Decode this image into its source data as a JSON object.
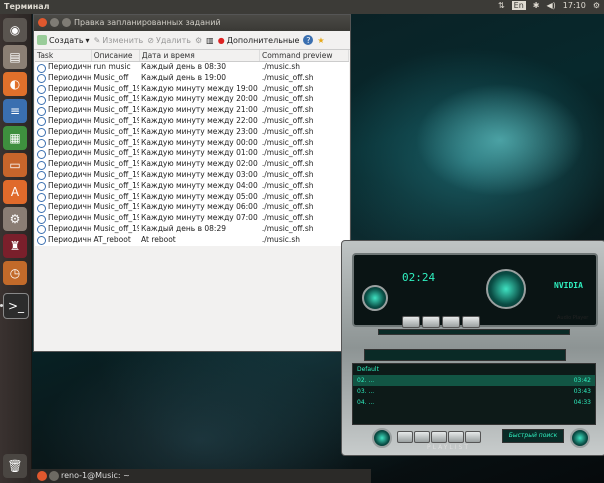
{
  "topbar": {
    "title": "Терминал",
    "time": "17:10",
    "lang": "En"
  },
  "taskbar": {
    "label": "reno-1@Music: ~"
  },
  "window": {
    "title": "Правка запланированных заданий",
    "toolbar": {
      "create": "Создать",
      "edit": "Изменить",
      "delete": "Удалить",
      "advanced": "Дополнительные"
    },
    "columns": [
      "Task",
      "Описание",
      "Дата и время",
      "Command preview"
    ],
    "rows": [
      [
        "Периодично",
        "run music",
        "Каждый день в 08:30",
        "./music.sh"
      ],
      [
        "Периодично",
        "Music_off",
        "Каждый день в 19:00",
        "./music_off.sh"
      ],
      [
        "Периодично",
        "Music_off_19",
        "Каждую минуту между 19:00 и 19:59",
        "./music_off.sh"
      ],
      [
        "Периодично",
        "Music_off_19",
        "Каждую минуту между 20:00 и 20:59",
        "./music_off.sh"
      ],
      [
        "Периодично",
        "Music_off_19",
        "Каждую минуту между 21:00 и 21:59",
        "./music_off.sh"
      ],
      [
        "Периодично",
        "Music_off_19",
        "Каждую минуту между 22:00 и 22:59",
        "./music_off.sh"
      ],
      [
        "Периодично",
        "Music_off_19",
        "Каждую минуту между 23:00 и 23:59",
        "./music_off.sh"
      ],
      [
        "Периодично",
        "Music_off_19",
        "Каждую минуту между 00:00 и 00:59",
        "./music_off.sh"
      ],
      [
        "Периодично",
        "Music_off_19",
        "Каждую минуту между 01:00 и 01:59",
        "./music_off.sh"
      ],
      [
        "Периодично",
        "Music_off_19",
        "Каждую минуту между 02:00 и 02:59",
        "./music_off.sh"
      ],
      [
        "Периодично",
        "Music_off_19",
        "Каждую минуту между 03:00 и 03:59",
        "./music_off.sh"
      ],
      [
        "Периодично",
        "Music_off_19",
        "Каждую минуту между 04:00 и 04:59",
        "./music_off.sh"
      ],
      [
        "Периодично",
        "Music_off_19",
        "Каждую минуту между 05:00 и 05:59",
        "./music_off.sh"
      ],
      [
        "Периодично",
        "Music_off_19",
        "Каждую минуту между 06:00 и 06:59",
        "./music_off.sh"
      ],
      [
        "Периодично",
        "Music_off_19",
        "Каждую минуту между 07:00 и 07:59",
        "./music_off.sh"
      ],
      [
        "Периодично",
        "Music_off_19",
        "Каждый день в 08:29",
        "./music_off.sh"
      ],
      [
        "Периодично",
        "AT_reboot",
        "At reboot",
        "./music.sh"
      ]
    ]
  },
  "player": {
    "time": "02:24",
    "brand": "NVIDIA",
    "subtitle": "Audio Player",
    "playlist_label": "PLAYLIST",
    "search_label": "Быстрый поиск",
    "default_label": "Default",
    "tracks": [
      "02. ...",
      "03. ...",
      "04. ..."
    ],
    "track_times": [
      "03:42",
      "03:43",
      "04:33"
    ]
  }
}
